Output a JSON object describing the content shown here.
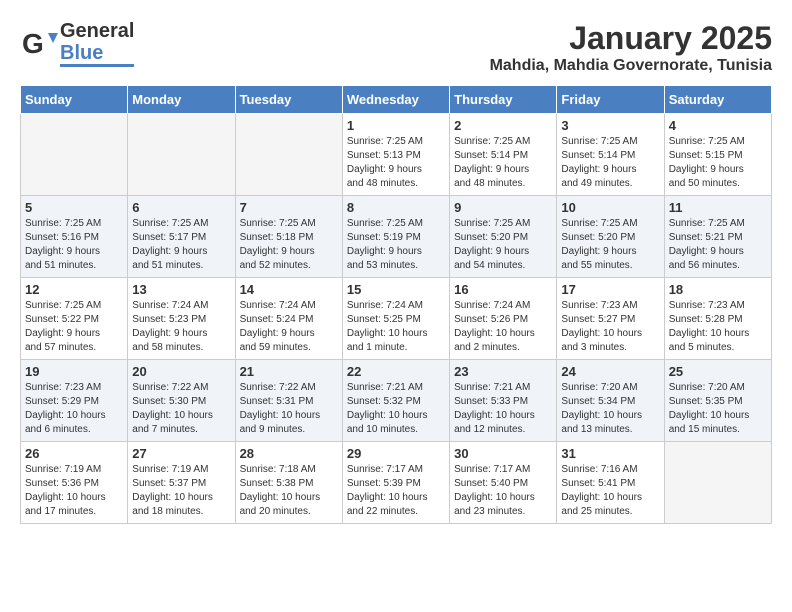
{
  "logo": {
    "general": "General",
    "blue": "Blue"
  },
  "title": "January 2025",
  "subtitle": "Mahdia, Mahdia Governorate, Tunisia",
  "weekdays": [
    "Sunday",
    "Monday",
    "Tuesday",
    "Wednesday",
    "Thursday",
    "Friday",
    "Saturday"
  ],
  "weeks": [
    [
      {
        "day": "",
        "info": ""
      },
      {
        "day": "",
        "info": ""
      },
      {
        "day": "",
        "info": ""
      },
      {
        "day": "1",
        "info": "Sunrise: 7:25 AM\nSunset: 5:13 PM\nDaylight: 9 hours\nand 48 minutes."
      },
      {
        "day": "2",
        "info": "Sunrise: 7:25 AM\nSunset: 5:14 PM\nDaylight: 9 hours\nand 48 minutes."
      },
      {
        "day": "3",
        "info": "Sunrise: 7:25 AM\nSunset: 5:14 PM\nDaylight: 9 hours\nand 49 minutes."
      },
      {
        "day": "4",
        "info": "Sunrise: 7:25 AM\nSunset: 5:15 PM\nDaylight: 9 hours\nand 50 minutes."
      }
    ],
    [
      {
        "day": "5",
        "info": "Sunrise: 7:25 AM\nSunset: 5:16 PM\nDaylight: 9 hours\nand 51 minutes."
      },
      {
        "day": "6",
        "info": "Sunrise: 7:25 AM\nSunset: 5:17 PM\nDaylight: 9 hours\nand 51 minutes."
      },
      {
        "day": "7",
        "info": "Sunrise: 7:25 AM\nSunset: 5:18 PM\nDaylight: 9 hours\nand 52 minutes."
      },
      {
        "day": "8",
        "info": "Sunrise: 7:25 AM\nSunset: 5:19 PM\nDaylight: 9 hours\nand 53 minutes."
      },
      {
        "day": "9",
        "info": "Sunrise: 7:25 AM\nSunset: 5:20 PM\nDaylight: 9 hours\nand 54 minutes."
      },
      {
        "day": "10",
        "info": "Sunrise: 7:25 AM\nSunset: 5:20 PM\nDaylight: 9 hours\nand 55 minutes."
      },
      {
        "day": "11",
        "info": "Sunrise: 7:25 AM\nSunset: 5:21 PM\nDaylight: 9 hours\nand 56 minutes."
      }
    ],
    [
      {
        "day": "12",
        "info": "Sunrise: 7:25 AM\nSunset: 5:22 PM\nDaylight: 9 hours\nand 57 minutes."
      },
      {
        "day": "13",
        "info": "Sunrise: 7:24 AM\nSunset: 5:23 PM\nDaylight: 9 hours\nand 58 minutes."
      },
      {
        "day": "14",
        "info": "Sunrise: 7:24 AM\nSunset: 5:24 PM\nDaylight: 9 hours\nand 59 minutes."
      },
      {
        "day": "15",
        "info": "Sunrise: 7:24 AM\nSunset: 5:25 PM\nDaylight: 10 hours\nand 1 minute."
      },
      {
        "day": "16",
        "info": "Sunrise: 7:24 AM\nSunset: 5:26 PM\nDaylight: 10 hours\nand 2 minutes."
      },
      {
        "day": "17",
        "info": "Sunrise: 7:23 AM\nSunset: 5:27 PM\nDaylight: 10 hours\nand 3 minutes."
      },
      {
        "day": "18",
        "info": "Sunrise: 7:23 AM\nSunset: 5:28 PM\nDaylight: 10 hours\nand 5 minutes."
      }
    ],
    [
      {
        "day": "19",
        "info": "Sunrise: 7:23 AM\nSunset: 5:29 PM\nDaylight: 10 hours\nand 6 minutes."
      },
      {
        "day": "20",
        "info": "Sunrise: 7:22 AM\nSunset: 5:30 PM\nDaylight: 10 hours\nand 7 minutes."
      },
      {
        "day": "21",
        "info": "Sunrise: 7:22 AM\nSunset: 5:31 PM\nDaylight: 10 hours\nand 9 minutes."
      },
      {
        "day": "22",
        "info": "Sunrise: 7:21 AM\nSunset: 5:32 PM\nDaylight: 10 hours\nand 10 minutes."
      },
      {
        "day": "23",
        "info": "Sunrise: 7:21 AM\nSunset: 5:33 PM\nDaylight: 10 hours\nand 12 minutes."
      },
      {
        "day": "24",
        "info": "Sunrise: 7:20 AM\nSunset: 5:34 PM\nDaylight: 10 hours\nand 13 minutes."
      },
      {
        "day": "25",
        "info": "Sunrise: 7:20 AM\nSunset: 5:35 PM\nDaylight: 10 hours\nand 15 minutes."
      }
    ],
    [
      {
        "day": "26",
        "info": "Sunrise: 7:19 AM\nSunset: 5:36 PM\nDaylight: 10 hours\nand 17 minutes."
      },
      {
        "day": "27",
        "info": "Sunrise: 7:19 AM\nSunset: 5:37 PM\nDaylight: 10 hours\nand 18 minutes."
      },
      {
        "day": "28",
        "info": "Sunrise: 7:18 AM\nSunset: 5:38 PM\nDaylight: 10 hours\nand 20 minutes."
      },
      {
        "day": "29",
        "info": "Sunrise: 7:17 AM\nSunset: 5:39 PM\nDaylight: 10 hours\nand 22 minutes."
      },
      {
        "day": "30",
        "info": "Sunrise: 7:17 AM\nSunset: 5:40 PM\nDaylight: 10 hours\nand 23 minutes."
      },
      {
        "day": "31",
        "info": "Sunrise: 7:16 AM\nSunset: 5:41 PM\nDaylight: 10 hours\nand 25 minutes."
      },
      {
        "day": "",
        "info": ""
      }
    ]
  ]
}
